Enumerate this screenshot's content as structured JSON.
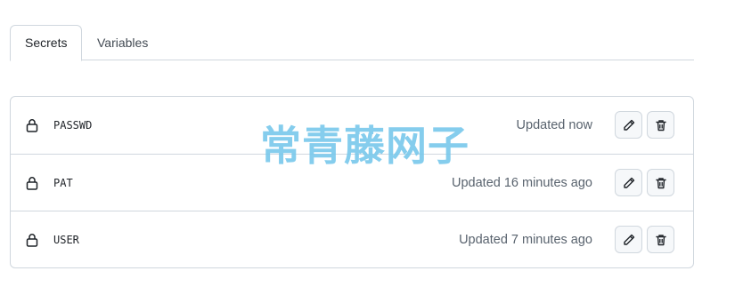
{
  "tabs": [
    {
      "label": "Secrets",
      "active": true
    },
    {
      "label": "Variables",
      "active": false
    }
  ],
  "secrets": [
    {
      "name": "PASSWD",
      "updated": "Updated now"
    },
    {
      "name": "PAT",
      "updated": "Updated 16 minutes ago"
    },
    {
      "name": "USER",
      "updated": "Updated 7 minutes ago"
    }
  ],
  "icons": {
    "row": "lock-icon",
    "edit": "pencil-icon",
    "delete": "trash-icon"
  },
  "watermark": "常青藤网子",
  "colors": {
    "border": "#d0d7de",
    "muted_text": "#59636e",
    "button_bg": "#f6f8fa",
    "watermark": "#78c8ec"
  }
}
